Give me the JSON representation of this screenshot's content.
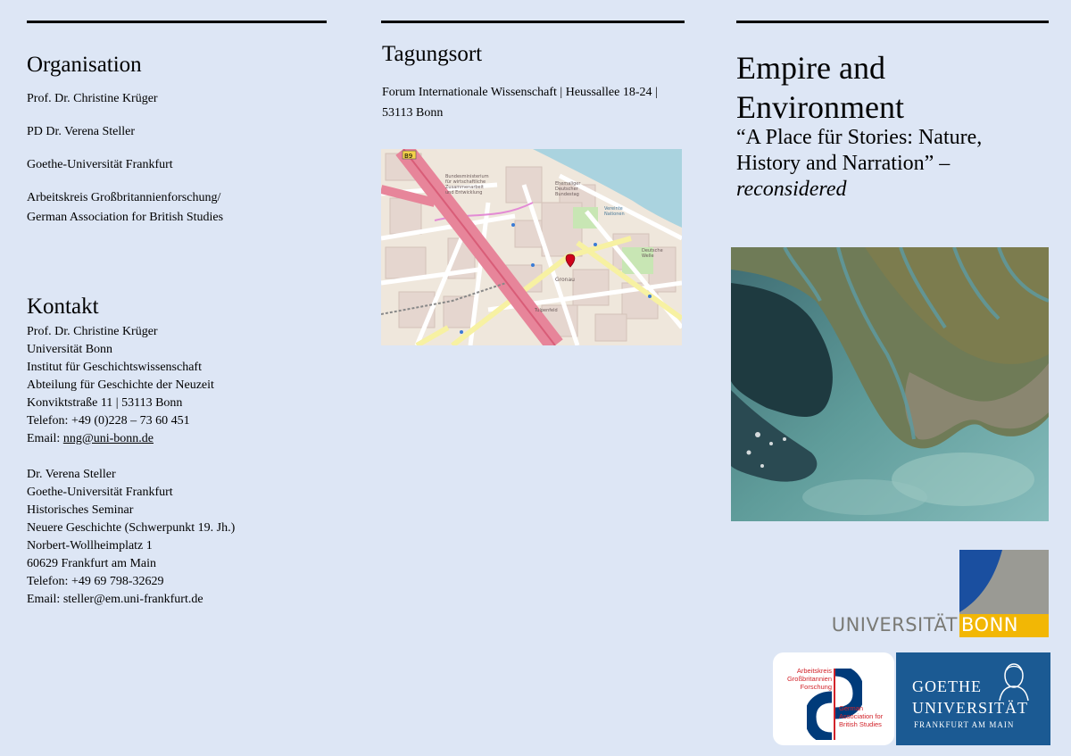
{
  "colors": {
    "background": "#dde6f5",
    "bonn_blue": "#1a4fa0",
    "bonn_gray": "#9a9a94",
    "bonn_yellow": "#f2b705",
    "goethe_blue": "#1b5a93",
    "akgb_red": "#d2232a",
    "akgb_blue": "#003b7a"
  },
  "organisation": {
    "heading": "Organisation",
    "items": [
      "Prof. Dr. Christine Krüger",
      "PD Dr. Verena Steller",
      "Goethe-Universität Frankfurt",
      "Arbeitskreis Großbritannienforschung/",
      "German Association for British Studies"
    ]
  },
  "kontakt": {
    "heading": "Kontakt",
    "block1": [
      "Prof. Dr. Christine Krüger",
      "Universität Bonn",
      "Institut für Geschichtswissenschaft",
      "Abteilung für Geschichte der Neuzeit",
      "Konviktstraße 11 | 53113 Bonn",
      "Telefon: +49 (0)228 – 73 60 451"
    ],
    "email1_label": "Email: ",
    "email1": "nng@uni-bonn.de",
    "block2": [
      "Dr. Verena Steller",
      "Goethe-Universität Frankfurt",
      "Historisches Seminar",
      "Neuere Geschichte (Schwerpunkt 19. Jh.)",
      "Norbert-Wollheimplatz 1",
      "60629 Frankfurt am Main",
      "Telefon: +49 69 798-32629",
      "Email: steller@em.uni-frankfurt.de"
    ]
  },
  "tagungsort": {
    "heading": "Tagungsort",
    "line1": "Forum Internationale Wissenschaft | Heussallee 18-24 |",
    "line2": "53113 Bonn"
  },
  "map": {
    "road_number": "B9",
    "labels": {
      "bundesministerium": [
        "Bundesministerium",
        "für wirtschaftliche",
        "Zusammenarbeit",
        "und Entwicklung"
      ],
      "bundestag": [
        "Ehemaliger",
        "Deutscher",
        "Bundestag"
      ],
      "nationen": [
        "Vereinte",
        "Nationen"
      ],
      "welle": [
        "Deutsche",
        "Welle"
      ],
      "gronau": "Gronau",
      "tulpenfeld": "Tulpenfeld"
    }
  },
  "title": {
    "line1": "Empire and",
    "line2": "Environment",
    "subtitle1": "“A Place für Stories: Nature,",
    "subtitle2": "History and Narration” –",
    "subtitle3": "reconsidered"
  },
  "logos": {
    "bonn_left": "UNIVERSITÄT",
    "bonn_right": "BONN",
    "akgb_top": [
      "Arbeitskreis",
      "Großbritannien",
      "Forschung"
    ],
    "akgb_bottom": [
      "German",
      "Association for",
      "British Studies"
    ],
    "goethe_1": "GOETHE",
    "goethe_2": "UNIVERSITÄT",
    "goethe_3": "FRANKFURT AM MAIN"
  }
}
